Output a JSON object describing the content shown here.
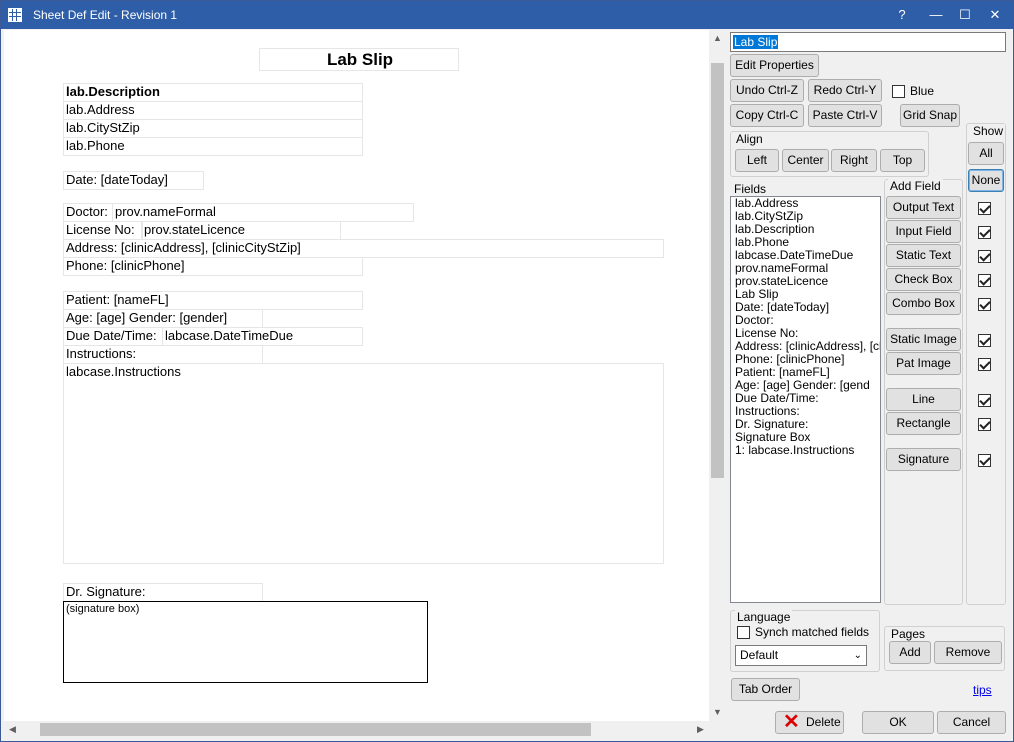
{
  "window": {
    "title": "Sheet Def Edit - Revision 1",
    "controls": {
      "help": "?",
      "minimize": "—",
      "maximize": "☐",
      "close": "✕"
    }
  },
  "canvas": {
    "title": "Lab Slip",
    "fields": {
      "lab_description": "lab.Description",
      "lab_address": "lab.Address",
      "lab_citystzip": "lab.CityStZip",
      "lab_phone": "lab.Phone",
      "date": "Date:  [dateToday]",
      "doctor_label": "Doctor:",
      "doctor_value": "prov.nameFormal",
      "license_label": "License No:",
      "license_value": "prov.stateLicence",
      "address": "Address:  [clinicAddress],  [clinicCityStZip]",
      "phone": "Phone:  [clinicPhone]",
      "patient": "Patient:  [nameFL]",
      "age": "Age: [age]       Gender: [gender]",
      "due_label": "Due Date/Time:",
      "due_value": "labcase.DateTimeDue",
      "instructions_label": "Instructions:",
      "instructions_value": "labcase.Instructions",
      "signature_label": "Dr. Signature:",
      "signature_box": "(signature box)"
    }
  },
  "panel": {
    "name_value": "Lab Slip",
    "buttons": {
      "edit_properties": "Edit Properties",
      "undo": "Undo Ctrl-Z",
      "redo": "Redo Ctrl-Y",
      "copy": "Copy Ctrl-C",
      "paste": "Paste Ctrl-V",
      "grid_snap": "Grid Snap"
    },
    "blue_checkbox": {
      "label": "Blue",
      "checked": false
    },
    "align": {
      "label": "Align",
      "buttons": [
        "Left",
        "Center",
        "Right",
        "Top"
      ]
    },
    "show": {
      "label": "Show",
      "all": "All",
      "none": "None",
      "checks": [
        true,
        true,
        true,
        true,
        true,
        true,
        true,
        true,
        true,
        true
      ]
    },
    "fields_label": "Fields",
    "fields_list": [
      "lab.Address",
      "lab.CityStZip",
      "lab.Description",
      "lab.Phone",
      "labcase.DateTimeDue",
      "prov.nameFormal",
      "prov.stateLicence",
      "Lab Slip",
      "Date:  [dateToday]",
      "Doctor:",
      "License No:",
      "Address:  [clinicAddress],  [cl",
      "Phone:  [clinicPhone]",
      "Patient:  [nameFL]",
      "Age: [age]       Gender: [gend",
      "Due Date/Time:",
      "Instructions:",
      "Dr. Signature:",
      "Signature Box",
      "1: labcase.Instructions"
    ],
    "add_field": {
      "label": "Add Field",
      "buttons": [
        "Output Text",
        "Input Field",
        "Static Text",
        "Check Box",
        "Combo Box",
        "Static Image",
        "Pat Image",
        "Line",
        "Rectangle",
        "Signature"
      ]
    },
    "language": {
      "label": "Language",
      "synch_label": "Synch matched fields",
      "synch_checked": false,
      "selected": "Default"
    },
    "pages": {
      "label": "Pages",
      "add": "Add",
      "remove": "Remove"
    },
    "tab_order": "Tab Order",
    "tips": "tips",
    "delete": "Delete",
    "ok": "OK",
    "cancel": "Cancel"
  }
}
